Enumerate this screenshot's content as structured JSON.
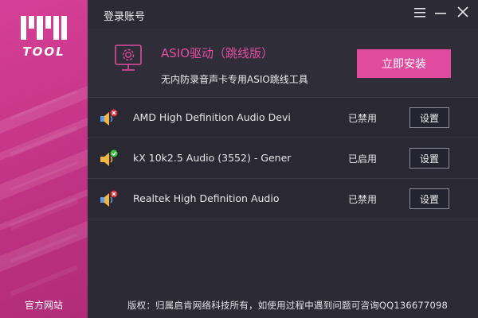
{
  "sidebar": {
    "logo_text": "TOOL",
    "site_link": "官方网站"
  },
  "window": {
    "title": "登录账号",
    "menu_icon": "menu-icon",
    "minimize_icon": "minimize-icon",
    "close_icon": "close-icon"
  },
  "header": {
    "icon": "monitor-gear-icon",
    "title": "ASIO驱动（跳线版）",
    "subtitle": "无内防录音声卡专用ASIO跳线工具",
    "install_label": "立即安装"
  },
  "devices": [
    {
      "name": "AMD High Definition Audio Devi",
      "status": "已禁用",
      "state": "disabled",
      "button": "设置"
    },
    {
      "name": "kX 10k2.5 Audio (3552) - Gener",
      "status": "已启用",
      "state": "enabled",
      "button": "设置"
    },
    {
      "name": "Realtek High Definition Audio",
      "status": "已禁用",
      "state": "disabled",
      "button": "设置"
    }
  ],
  "footer": {
    "copyright": "版权：归属启肯网络科技所有，如使用过程中遇到问题可咨询QQ136677098"
  },
  "colors": {
    "accent": "#e04a9f",
    "sidebar": "#c03283",
    "background": "#2b2a35",
    "enabled": "#3ec23e",
    "disabled": "#e0303a"
  }
}
